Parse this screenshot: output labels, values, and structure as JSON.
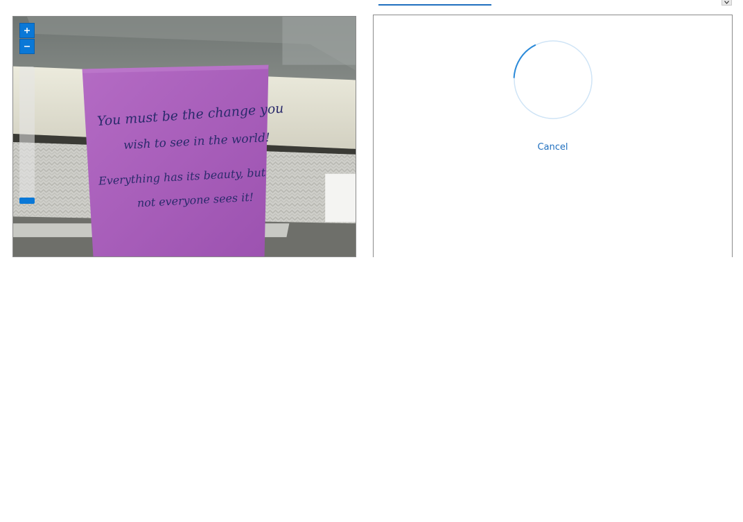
{
  "viewer": {
    "zoom_in_icon": "plus-icon",
    "zoom_out_icon": "minus-icon",
    "note_text": {
      "line1": "You must be the change you",
      "line2": "wish to see in the world!",
      "line3": "Everything has its beauty, but",
      "line4": "not everyone sees it!"
    }
  },
  "result": {
    "status": "loading",
    "cancel_label": "Cancel"
  },
  "colors": {
    "accent": "#0a78d7",
    "link": "#1f6fbf",
    "note_purple": "#a65cb8"
  }
}
